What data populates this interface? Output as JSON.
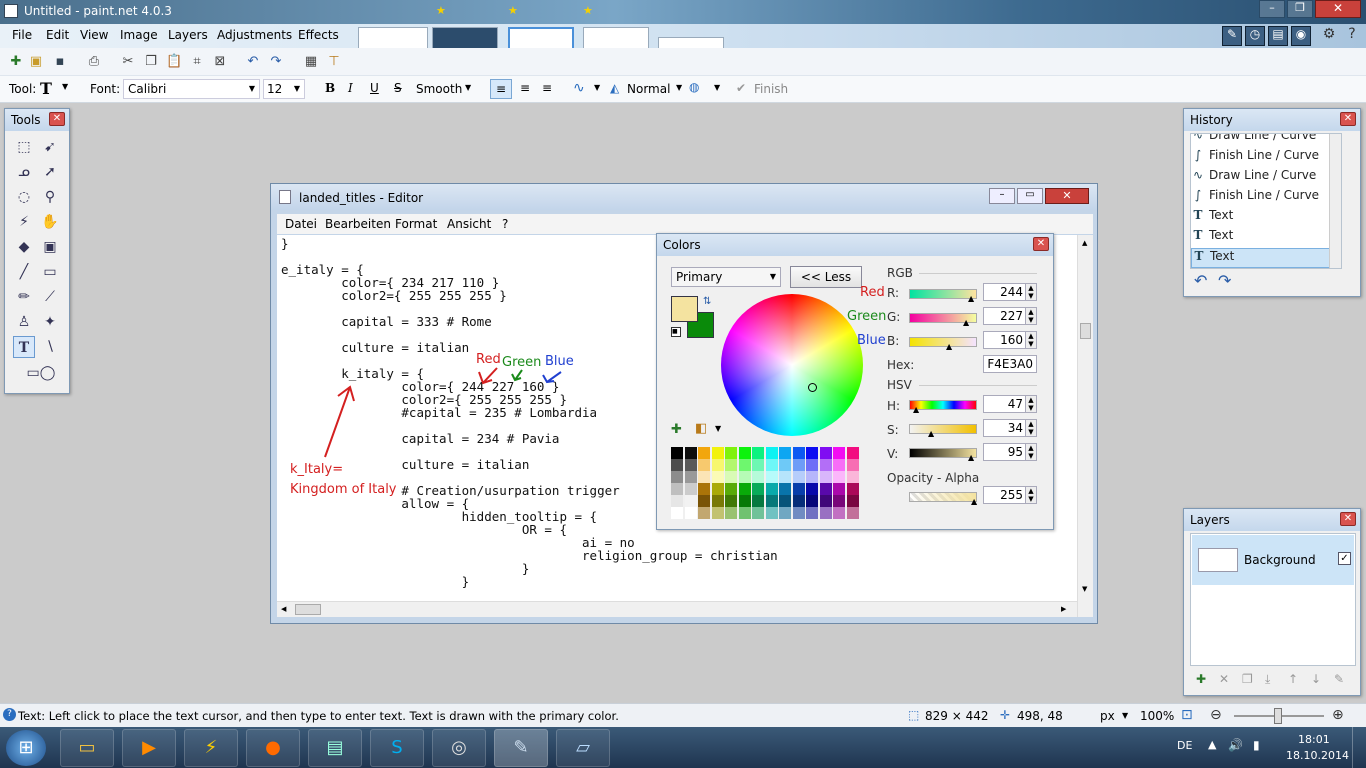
{
  "app": {
    "title": "Untitled - paint.net 4.0.3"
  },
  "menu": [
    "File",
    "Edit",
    "View",
    "Image",
    "Layers",
    "Adjustments",
    "Effects"
  ],
  "toolbar": {
    "tool_label": "Tool:",
    "font_label": "Font:",
    "font_value": "Calibri",
    "size_value": "12",
    "bold": "B",
    "italic": "I",
    "underline": "U",
    "strike": "S",
    "antialias": "Smooth",
    "blend": "Normal",
    "finish": "Finish"
  },
  "tools_panel": {
    "title": "Tools"
  },
  "history_panel": {
    "title": "History",
    "items": [
      {
        "label": "Draw Line / Curve",
        "icon": "curve-icon"
      },
      {
        "label": "Finish Line / Curve",
        "icon": "finish-curve-icon"
      },
      {
        "label": "Draw Line / Curve",
        "icon": "curve-icon"
      },
      {
        "label": "Finish Line / Curve",
        "icon": "finish-curve-icon"
      },
      {
        "label": "Text",
        "icon": "text-icon"
      },
      {
        "label": "Text",
        "icon": "text-icon"
      },
      {
        "label": "Text",
        "icon": "text-icon"
      }
    ]
  },
  "layers_panel": {
    "title": "Layers",
    "layer_name": "Background"
  },
  "editor": {
    "title": "landed_titles - Editor",
    "menu": [
      "Datei",
      "Bearbeiten",
      "Format",
      "Ansicht",
      "?"
    ],
    "lines": [
      "}",
      "",
      "e_italy = {",
      "        color={ 234 217 110 }",
      "        color2={ 255 255 255 }",
      "",
      "        capital = 333 # Rome",
      "",
      "        culture = italian",
      "",
      "        k_italy = {",
      "                color={ 244 227 160 }",
      "                color2={ 255 255 255 }",
      "                #capital = 235 # Lombardia",
      "",
      "                capital = 234 # Pavia",
      "",
      "                culture = italian",
      "",
      "                # Creation/usurpation trigger",
      "                allow = {",
      "                        hidden_tooltip = {",
      "                                OR = {",
      "                                        ai = no",
      "                                        religion_group = christian",
      "                                }",
      "                        }"
    ]
  },
  "annotations": {
    "red": "Red",
    "green": "Green",
    "blue": "Blue",
    "k_italy_line1": "k_Italy=",
    "k_italy_line2": "Kingdom of Italy",
    "side_red": "Red",
    "side_green": "Green",
    "side_blue": "Blue"
  },
  "colors_dialog": {
    "title": "Colors",
    "mode": "Primary",
    "less_button": "<< Less",
    "rgb_label": "RGB",
    "r_label": "R:",
    "g_label": "G:",
    "b_label": "B:",
    "r_value": "244",
    "g_value": "227",
    "b_value": "160",
    "hex_label": "Hex:",
    "hex_value": "F4E3A0",
    "hsv_label": "HSV",
    "h_label": "H:",
    "s_label": "S:",
    "v_label": "V:",
    "h_value": "47",
    "s_value": "34",
    "v_value": "95",
    "opacity_label": "Opacity - Alpha",
    "alpha_value": "255",
    "primary_color": "#F4E3A0",
    "secondary_color": "#0A8A0A"
  },
  "status": {
    "hint": "Text: Left click to place the text cursor, and then type to enter text. Text is drawn with the primary color.",
    "selection_size": "829 × 442",
    "cursor_pos": "498, 48",
    "units": "px",
    "zoom": "100%"
  },
  "taskbar": {
    "lang": "DE",
    "time": "18:01",
    "date": "18.10.2014"
  }
}
